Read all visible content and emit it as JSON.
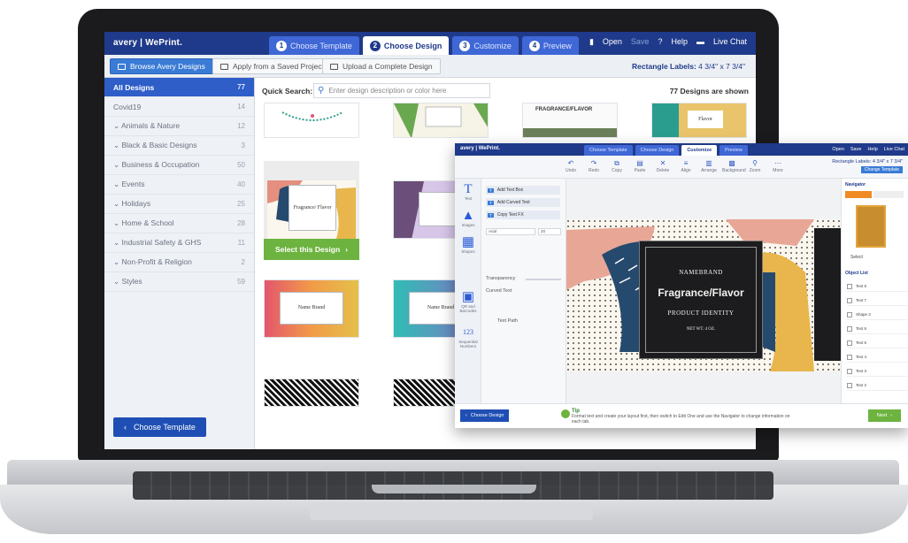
{
  "app": {
    "logo": "avery | WePrint.",
    "tabs": [
      {
        "num": "1",
        "label": "Choose Template"
      },
      {
        "num": "2",
        "label": "Choose Design"
      },
      {
        "num": "3",
        "label": "Customize"
      },
      {
        "num": "4",
        "label": "Preview"
      }
    ],
    "top_actions": {
      "open": "Open",
      "save": "Save",
      "help": "Help",
      "live_chat": "Live Chat"
    }
  },
  "subbar": {
    "browse": "Browse Avery Designs",
    "apply": "Apply from a Saved Project",
    "upload": "Upload a Complete Design",
    "rect_label": "Rectangle Labels:",
    "rect_size": "4 3/4\" x 7 3/4\""
  },
  "sidebar": {
    "items": [
      {
        "label": "All Designs",
        "count": "77"
      },
      {
        "label": "Covid19",
        "count": "14"
      },
      {
        "label": "Animals & Nature",
        "count": "12"
      },
      {
        "label": "Black & Basic Designs",
        "count": "3"
      },
      {
        "label": "Business & Occupation",
        "count": "50"
      },
      {
        "label": "Events",
        "count": "40"
      },
      {
        "label": "Holidays",
        "count": "25"
      },
      {
        "label": "Home & School",
        "count": "28"
      },
      {
        "label": "Industrial Safety & GHS",
        "count": "11"
      },
      {
        "label": "Non-Profit & Religion",
        "count": "2"
      },
      {
        "label": "Styles",
        "count": "59"
      }
    ],
    "back_button": "Choose Template"
  },
  "main": {
    "quick_search_label": "Quick Search:",
    "search_placeholder": "Enter design description or color here",
    "designs_shown": "77 Designs are shown",
    "select_button": "Select this Design",
    "card_lines": {
      "fragrance": "FRAGRANCE/FLAVOR",
      "fragrant": "Fragrance/ Flavor",
      "name_brand": "Name Brand",
      "flavor": "Flavor"
    }
  },
  "customize": {
    "logo": "avery | WePrint.",
    "tabs": [
      "Choose Template",
      "Choose Design",
      "Customize",
      "Preview"
    ],
    "actions": [
      "Open",
      "Save",
      "Help",
      "Live Chat"
    ],
    "tools": [
      "Undo",
      "Redo",
      "Copy",
      "Paste",
      "Delete",
      "Align",
      "Arrange",
      "Background",
      "Zoom",
      "More"
    ],
    "rect_label": "Rectangle Labels: 4 3/4\" x 7 3/4\"",
    "change_template": "Change Template",
    "rail": [
      {
        "glyph": "T",
        "label": "Text"
      },
      {
        "glyph": "▲",
        "label": "Images"
      },
      {
        "glyph": "▦",
        "label": "Shapes"
      },
      {
        "glyph": "▣",
        "label": "QR and Barcodes"
      },
      {
        "glyph": "123",
        "label": "Sequential Numbers"
      }
    ],
    "panel": {
      "add_text_box": "Add Text Box",
      "add_curved_text": "Add Curved Text",
      "copy_text_fx": "Copy Text FX",
      "font": "Arial",
      "size": "20",
      "transparency": "Transparency",
      "curved_text": "Curved Text",
      "text_path": "Text Path"
    },
    "label": {
      "brand": "NAMEBRAND",
      "title": "Fragrance/Flavor",
      "identity": "PRODUCT IDENTITY",
      "weight": "NET WT. 4 OZ."
    },
    "navigator": "Navigator",
    "object_list": "Object List",
    "select_label": "Select",
    "layers": [
      "Text 8",
      "Text 7",
      "Shape 3",
      "Text 6",
      "Text 5",
      "Text 4",
      "Text 3",
      "Text 2"
    ],
    "back_button": "Choose Design",
    "tip_title": "Tip",
    "tip_text": "Format text and create your layout first, then switch to Edit One and use the Navigator to change information on each tab.",
    "next_button": "Next"
  }
}
